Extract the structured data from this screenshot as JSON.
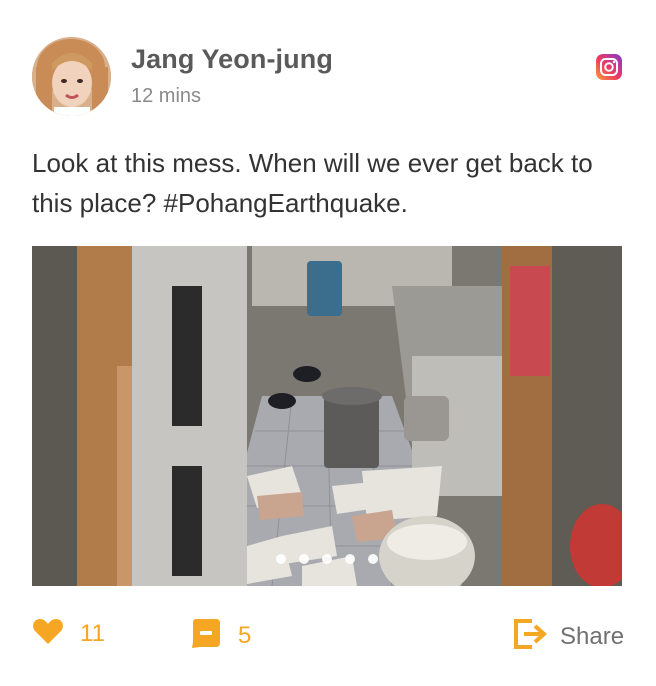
{
  "author": {
    "name": "Jang Yeon-jung",
    "time": "12 mins",
    "source_icon": "instagram-icon"
  },
  "post": {
    "text": "Look at this mess. When will we ever get back to this place? #PohangEarthquake."
  },
  "media": {
    "carousel_total": 5,
    "carousel_active": 5
  },
  "actions": {
    "likes": "11",
    "comments": "5",
    "share_label": "Share"
  },
  "colors": {
    "accent": "#f5a623",
    "name_text": "#5a5a5a",
    "body_text": "#333333",
    "meta_text": "#8a8a8a"
  }
}
